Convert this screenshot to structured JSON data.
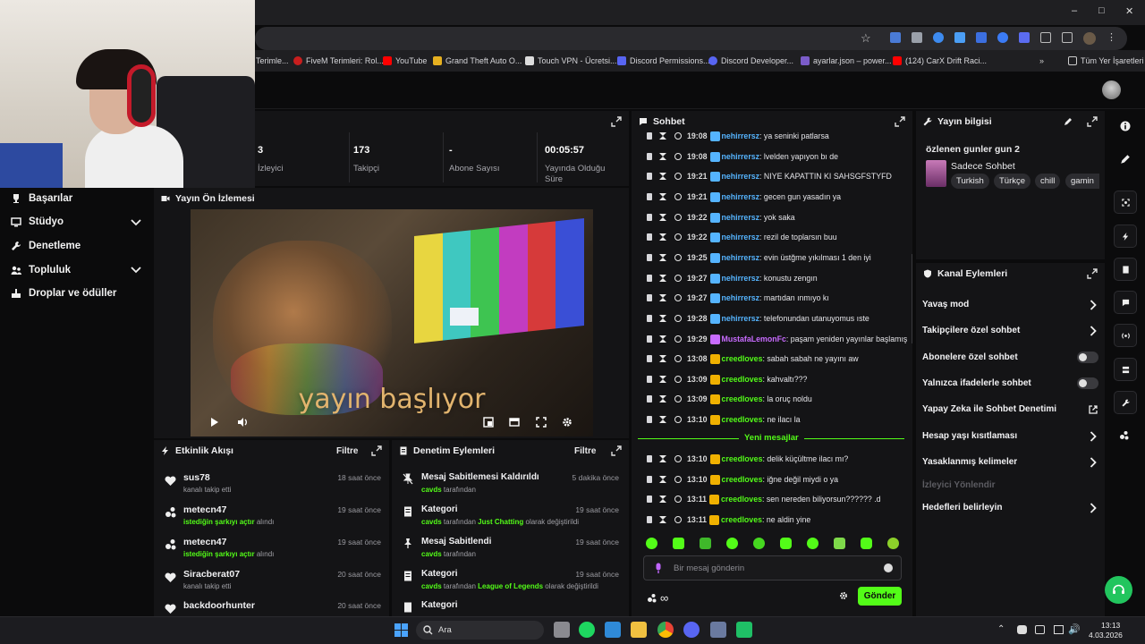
{
  "browser": {
    "bookmarks": [
      {
        "label": "Terimle..."
      },
      {
        "label": "FiveM Terimleri: Rol..."
      },
      {
        "label": "YouTube"
      },
      {
        "label": "Grand Theft Auto O..."
      },
      {
        "label": "Touch VPN - Ücretsi..."
      },
      {
        "label": "Discord Permissions..."
      },
      {
        "label": "Discord Developer..."
      },
      {
        "label": "ayarlar.json – power..."
      },
      {
        "label": "(124) CarX Drift Raci..."
      }
    ],
    "all_bookmarks_label": "Tüm Yer İşaretleri",
    "colors": {
      "accent": "#53fc18",
      "panel": "#141416",
      "background": "#0b0b0c"
    }
  },
  "sidebar": {
    "items": [
      {
        "label": "Başarılar",
        "icon": "trophy-icon"
      },
      {
        "label": "Stüdyo",
        "icon": "studio-icon"
      },
      {
        "label": "Denetleme",
        "icon": "wrench-icon"
      },
      {
        "label": "Topluluk",
        "icon": "community-icon"
      },
      {
        "label": "Droplar ve ödüller",
        "icon": "drops-icon"
      }
    ]
  },
  "stats": [
    {
      "value": "3",
      "label": "İzleyici"
    },
    {
      "value": "173",
      "label": "Takipçi"
    },
    {
      "value": "-",
      "label": "Abone Sayısı"
    },
    {
      "value": "00:05:57",
      "label": "Yayında Olduğu Süre"
    }
  ],
  "preview": {
    "title": "Yayın Ön İzlemesi",
    "caption": "yayın başlıyor"
  },
  "activity": {
    "title": "Etkinlik Akışı",
    "filter": "Filtre",
    "items": [
      {
        "name": "sus78",
        "sub": "kanalı takip etti",
        "highlight": "",
        "time": "18 saat önce",
        "icon": "heart-icon"
      },
      {
        "name": "metecn47",
        "sub": " alındı",
        "highlight": "istediğin şarkıyı açtır",
        "time": "19 saat önce",
        "icon": "drops-icon"
      },
      {
        "name": "metecn47",
        "sub": " alındı",
        "highlight": "istediğin şarkıyı açtır",
        "time": "19 saat önce",
        "icon": "drops-icon"
      },
      {
        "name": "Siracberat07",
        "sub": "kanalı takip etti",
        "highlight": "",
        "time": "20 saat önce",
        "icon": "heart-icon"
      },
      {
        "name": "backdoorhunter",
        "sub": "",
        "highlight": "",
        "time": "20 saat önce",
        "icon": "heart-icon"
      }
    ]
  },
  "moderation": {
    "title": "Denetim Eylemleri",
    "filter": "Filtre",
    "items": [
      {
        "title": "Mesaj Sabitlemesi Kaldırıldı",
        "user": "cavds",
        "sub": " tarafından",
        "extra": "",
        "extra_tail": "",
        "time": "5 dakika önce"
      },
      {
        "title": "Kategori",
        "user": "cavds",
        "sub": " tarafından ",
        "extra": "Just Chatting",
        "extra_tail": " olarak değiştirildi",
        "time": "19 saat önce"
      },
      {
        "title": "Mesaj Sabitlendi",
        "user": "cavds",
        "sub": " tarafından",
        "extra": "",
        "extra_tail": "",
        "time": "19 saat önce"
      },
      {
        "title": "Kategori",
        "user": "cavds",
        "sub": " tarafından ",
        "extra": "League of Legends",
        "extra_tail": " olarak değiştirildi",
        "time": "19 saat önce"
      },
      {
        "title": "Kategori",
        "user": "",
        "sub": "",
        "extra": "",
        "extra_tail": "",
        "time": ""
      }
    ]
  },
  "chat": {
    "title": "Sohbet",
    "messages": [
      {
        "time": "19:08",
        "user": "nehirrersz",
        "text": ": ya seninki patlarsa",
        "cls": "u-neh"
      },
      {
        "time": "19:08",
        "user": "nehirrersz",
        "text": ": lvelden yapıyon bı de",
        "cls": "u-neh"
      },
      {
        "time": "19:21",
        "user": "nehirrersz",
        "text": ": NIYE KAPATTIN KI SAHSGFSTYFD",
        "cls": "u-neh"
      },
      {
        "time": "19:21",
        "user": "nehirrersz",
        "text": ": gecen gun yasadın ya",
        "cls": "u-neh"
      },
      {
        "time": "19:22",
        "user": "nehirrersz",
        "text": ": yok saka",
        "cls": "u-neh"
      },
      {
        "time": "19:22",
        "user": "nehirrersz",
        "text": ": rezil de toplarsın buu",
        "cls": "u-neh"
      },
      {
        "time": "19:25",
        "user": "nehirrersz",
        "text": ": evin üstğme yıkılması 1 den iyi",
        "cls": "u-neh"
      },
      {
        "time": "19:27",
        "user": "nehirrersz",
        "text": ": konustu zengın",
        "cls": "u-neh"
      },
      {
        "time": "19:27",
        "user": "nehirrersz",
        "text": ": martıdan ınmıyo kı",
        "cls": "u-neh"
      },
      {
        "time": "19:28",
        "user": "nehirrersz",
        "text": ": telefonundan utanuyomus ıste",
        "cls": "u-neh"
      },
      {
        "time": "19:29",
        "user": "MustafaLemonFc",
        "text": ": paşam yeniden yayınlar başlamış",
        "cls": "u-must"
      },
      {
        "time": "13:08",
        "user": "creedloves",
        "text": ": sabah sabah ne yayını aw",
        "cls": "u-creed"
      },
      {
        "time": "13:09",
        "user": "creedloves",
        "text": ": kahvaltı???",
        "cls": "u-creed"
      },
      {
        "time": "13:09",
        "user": "creedloves",
        "text": ": la oruç noldu",
        "cls": "u-creed"
      },
      {
        "time": "13:10",
        "user": "creedloves",
        "text": ": ne ilacı la",
        "cls": "u-creed"
      }
    ],
    "new_messages_label": "Yeni mesajlar",
    "new_messages": [
      {
        "time": "13:10",
        "user": "creedloves",
        "text": ": delik küçültme ilacı mı?",
        "cls": "u-creed"
      },
      {
        "time": "13:10",
        "user": "creedloves",
        "text": ": iğne değil miydi o ya",
        "cls": "u-creed"
      },
      {
        "time": "13:11",
        "user": "creedloves",
        "text": ": sen nereden biliyorsun?????? .d",
        "cls": "u-creed"
      },
      {
        "time": "13:11",
        "user": "creedloves",
        "text": ": ne aldin yine",
        "cls": "u-creed"
      }
    ],
    "input_placeholder": "Bir mesaj gönderin",
    "send_label": "Gönder",
    "points_label": "∞"
  },
  "stream_info": {
    "title": "Yayın bilgisi",
    "stream_title": "özlenen gunler gun 2",
    "category": "Sadece Sohbet",
    "tags": [
      "Turkish",
      "Türkçe",
      "chill",
      "gamin"
    ]
  },
  "channel_actions": {
    "title": "Kanal Eylemleri",
    "items": [
      {
        "label": "Yavaş mod",
        "control": "arrow"
      },
      {
        "label": "Takipçilere özel sohbet",
        "control": "arrow"
      },
      {
        "label": "Abonelere özel sohbet",
        "control": "toggle"
      },
      {
        "label": "Yalnızca ifadelerle sohbet",
        "control": "toggle"
      },
      {
        "label": "Yapay Zeka ile Sohbet Denetimi",
        "control": "external"
      },
      {
        "label": "Hesap yaşı kısıtlaması",
        "control": "arrow"
      },
      {
        "label": "Yasaklanmış kelimeler",
        "control": "arrow"
      },
      {
        "label": "İzleyici Yönlendir",
        "control": "disabled"
      },
      {
        "label": "Hedefleri belirleyin",
        "control": "arrow"
      }
    ]
  },
  "taskbar": {
    "search_label": "Ara",
    "clock_time": "13:13",
    "clock_date": "4.03.2026"
  }
}
